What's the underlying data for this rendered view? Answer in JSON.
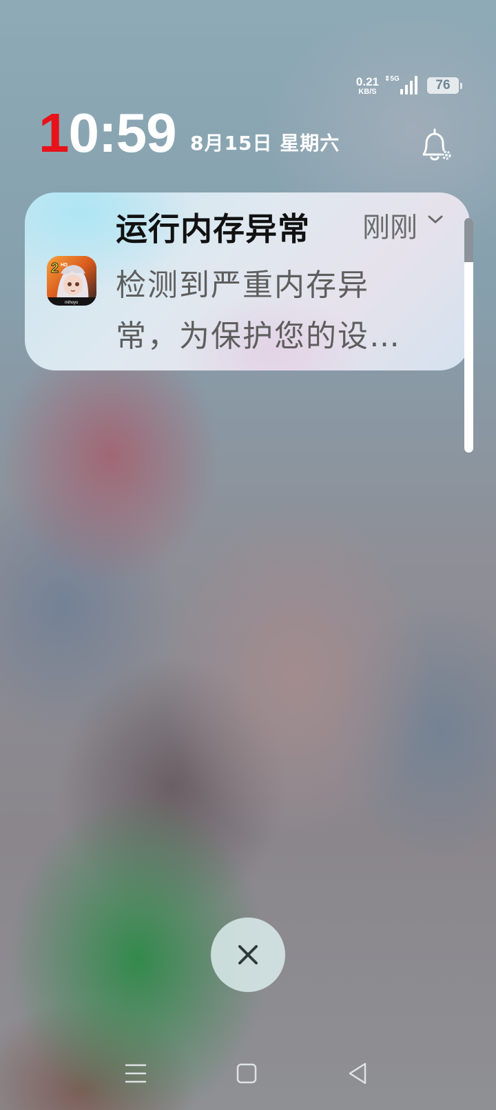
{
  "status_bar": {
    "net_speed_value": "0.21",
    "net_speed_unit": "KB/S",
    "network_type": "5G",
    "battery_level": "76"
  },
  "lock_screen": {
    "time_first_digit": "1",
    "time_rest": "0:59",
    "date": "8月15日 星期六",
    "accent_color": "#e8121a"
  },
  "notification": {
    "title": "运行内存异常",
    "time": "刚刚",
    "body": "检测到严重内存异常，为保护您的设…",
    "app_icon": "game-app-icon"
  },
  "icons": {
    "bell": "bell-settings-icon",
    "dismiss": "close-icon",
    "nav_menu": "menu-icon",
    "nav_home": "home-icon",
    "nav_back": "back-icon"
  }
}
